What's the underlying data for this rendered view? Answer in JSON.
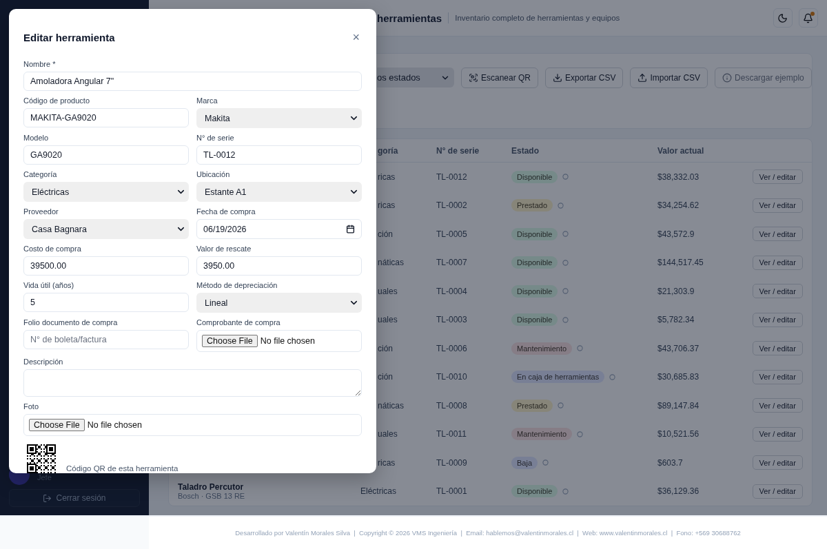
{
  "sidebar": {
    "user_role": "Jefe",
    "logout": "Cerrar sesión"
  },
  "header": {
    "title": "herramientas",
    "subtitle": "Inventario completo de herramientas y equipos",
    "notification": true
  },
  "toolbar": {
    "status_filter": "os estados",
    "buttons": [
      {
        "label": "Escanear QR",
        "kind": "qr",
        "disabled": false
      },
      {
        "label": "Exportar CSV",
        "kind": "download",
        "disabled": false
      },
      {
        "label": "Importar CSV",
        "kind": "upload",
        "disabled": false
      },
      {
        "label": "Descargar ejemplo",
        "kind": "info",
        "disabled": true
      }
    ]
  },
  "table": {
    "columns": [
      "goría",
      "N° de serie",
      "Estado",
      "Valor actual"
    ],
    "rows": [
      {
        "category": "ricas",
        "serial": "TL-0012",
        "status": "Disponible",
        "color": "#768a89",
        "value": "$38,332.03",
        "action": "Ver / editar"
      },
      {
        "category": "ricas",
        "serial": "TL-0002",
        "status": "Prestado",
        "color": "#878579",
        "value": "$34,254.62",
        "action": "Ver / editar"
      },
      {
        "category": "ción",
        "serial": "TL-0005",
        "status": "Disponible",
        "color": "#768a89",
        "value": "$43,572.9",
        "action": "Ver / editar"
      },
      {
        "category": "náticas",
        "serial": "TL-0007",
        "status": "Disponible",
        "color": "#768a89",
        "value": "$144,517.45",
        "action": "Ver / editar"
      },
      {
        "category": "uales",
        "serial": "TL-0004",
        "status": "Disponible",
        "color": "#768a89",
        "value": "$21,303.9",
        "action": "Ver / editar"
      },
      {
        "category": "uales",
        "serial": "TL-0003",
        "status": "Disponible",
        "color": "#768a89",
        "value": "$5,782.34",
        "action": "Ver / editar"
      },
      {
        "category": "ción",
        "serial": "TL-0006",
        "status": "Mantenimiento",
        "color": "#867d86",
        "value": "$43,706.37",
        "action": "Ver / editar"
      },
      {
        "category": "ción",
        "serial": "TL-0010",
        "status": "En caja de herramientas",
        "color": "#787f95",
        "value": "$30,685.83",
        "action": "Ver / editar"
      },
      {
        "category": "náticas",
        "serial": "TL-0008",
        "status": "Prestado",
        "color": "#878579",
        "value": "$89,147.84",
        "action": "Ver / editar"
      },
      {
        "category": "uales",
        "serial": "TL-0011",
        "status": "Mantenimiento",
        "color": "#867d86",
        "value": "$10,521.56",
        "action": "Ver / editar"
      },
      {
        "category": "ricas",
        "serial": "TL-0009",
        "status": "Baja",
        "color": "#787f95",
        "value": "$603.7",
        "action": "Ver / editar"
      },
      {
        "name": "Taladro Percutor",
        "subtitle": "Bosch · GSB 13 RE",
        "category": "Eléctricas",
        "serial": "TL-0001",
        "status": "Disponible",
        "color": "#768a89",
        "value": "$36,129.36",
        "action": "Ver / editar"
      }
    ]
  },
  "modal": {
    "title": "Editar herramienta",
    "close": "×",
    "rows": [
      [
        {
          "label": "Nombre *",
          "kind": "text",
          "value": "Amoladora Angular 7\""
        }
      ],
      [
        {
          "label": "Código de producto",
          "kind": "text",
          "value": "MAKITA-GA9020"
        },
        {
          "label": "Marca",
          "kind": "select",
          "value": "Makita"
        }
      ],
      [
        {
          "label": "Modelo",
          "kind": "text",
          "value": "GA9020"
        },
        {
          "label": "N° de serie",
          "kind": "text",
          "value": "TL-0012"
        }
      ],
      [
        {
          "label": "Categoría",
          "kind": "select",
          "value": "Eléctricas"
        },
        {
          "label": "Ubicación",
          "kind": "select",
          "value": "Estante A1"
        }
      ],
      [
        {
          "label": "Proveedor",
          "kind": "select",
          "value": "Casa Bagnara"
        },
        {
          "label": "Fecha de compra",
          "kind": "date",
          "value": "06/19/2026"
        }
      ],
      [
        {
          "label": "Costo de compra",
          "kind": "text",
          "value": "39500.00"
        },
        {
          "label": "Valor de rescate",
          "kind": "text",
          "value": "3950.00"
        }
      ],
      [
        {
          "label": "Vida útil (años)",
          "kind": "text",
          "value": "5"
        },
        {
          "label": "Método de depreciación",
          "kind": "select",
          "value": "Lineal"
        }
      ],
      [
        {
          "label": "Folio documento de compra",
          "kind": "text",
          "placeholder": "N° de boleta/factura"
        },
        {
          "label": "Comprobante de compra",
          "kind": "file",
          "button": "Choose File",
          "value": "No file chosen"
        }
      ],
      [
        {
          "label": "Descripción",
          "kind": "textarea"
        }
      ],
      [
        {
          "label": "Foto",
          "kind": "file",
          "button": "Choose File",
          "value": "No file chosen"
        }
      ]
    ],
    "qr_caption": "Código QR de esta herramienta"
  },
  "footer": "Desarrollado por Valentín Morales Silva  |  Copyright © 2026 VMS Ingeniería  |  Email: hablemos@valentinmorales.cl  |  Web: www.valentinmorales.cl  |  Fono: +569 30688762"
}
